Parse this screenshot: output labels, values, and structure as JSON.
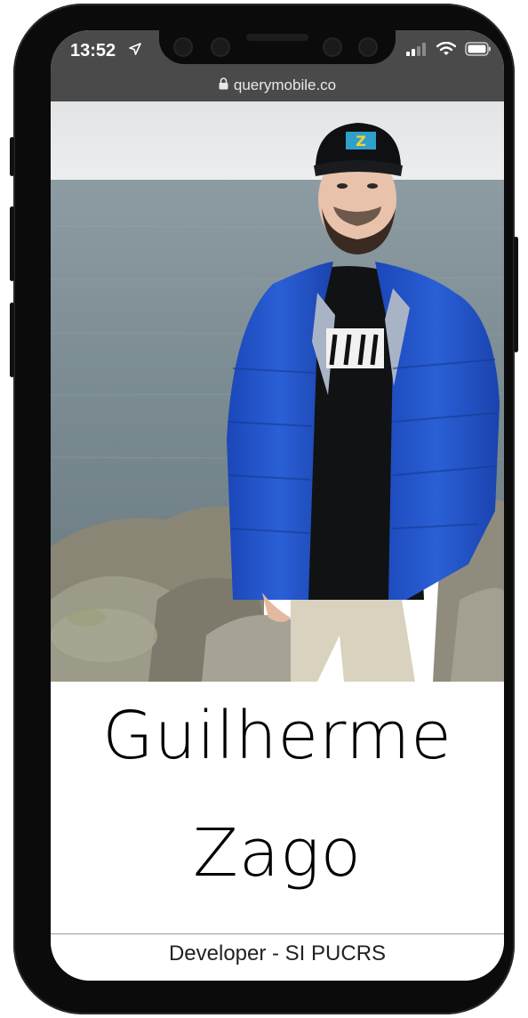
{
  "status_bar": {
    "time": "13:52",
    "location_icon": "location-arrow-icon"
  },
  "browser": {
    "url": "querymobile.co"
  },
  "profile": {
    "first_name": "Guilherme",
    "last_name": "Zago",
    "role": "Developer - SI PUCRS",
    "cap_logo": "Z"
  },
  "colors": {
    "statusbar_bg": "#4a4a4a",
    "jacket": "#1f4fc3",
    "sea": "#7e8f96",
    "sky": "#e9ebec"
  }
}
